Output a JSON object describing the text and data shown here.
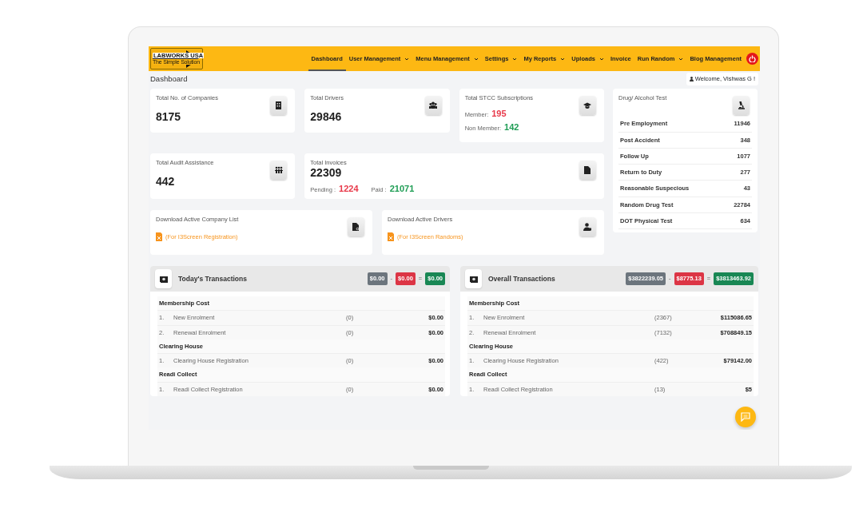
{
  "nav": {
    "logo_title": "LABWORKS USA",
    "logo_tagline": "The Simple Solution",
    "items": [
      {
        "label": "Dashboard",
        "selected": true,
        "dropdown": false
      },
      {
        "label": "User Management",
        "selected": false,
        "dropdown": true
      },
      {
        "label": "Menu Management",
        "selected": false,
        "dropdown": true
      },
      {
        "label": "Settings",
        "selected": false,
        "dropdown": true
      },
      {
        "label": "My Reports",
        "selected": false,
        "dropdown": true
      },
      {
        "label": "Uploads",
        "selected": false,
        "dropdown": true
      },
      {
        "label": "Invoice",
        "selected": false,
        "dropdown": false
      },
      {
        "label": "Run Random",
        "selected": false,
        "dropdown": true
      },
      {
        "label": "Blog Management",
        "selected": false,
        "dropdown": false
      }
    ]
  },
  "page_title": "Dashboard",
  "welcome": "Welcome, Vishwas G !",
  "stat_cards": [
    {
      "kind": "count",
      "title": "Total No. of Companies",
      "value": "8175"
    },
    {
      "kind": "count",
      "title": "Total Drivers",
      "value": "29846"
    },
    {
      "kind": "split",
      "title": "Total STCC Subscriptions",
      "lines": [
        {
          "label": "Member:",
          "value": "195",
          "color": "#e8394a"
        },
        {
          "label": "Non Member:",
          "value": "142",
          "color": "#1f9d55"
        }
      ]
    },
    {
      "kind": "count",
      "title": "Total Audit Assistance",
      "value": "442"
    },
    {
      "kind": "invoice",
      "title": "Total Invoices",
      "value": "22309",
      "lines": [
        {
          "label": "Pending :",
          "value": "1224",
          "color": "#e8394a"
        },
        {
          "label": "Paid :",
          "value": "21071",
          "color": "#1f9d55"
        }
      ]
    },
    {
      "kind": "download",
      "title": "Download Active Company List",
      "link": "(For I3Screen Registration)"
    },
    {
      "kind": "download",
      "title": "Download Active Drivers",
      "link": "(For I3Screen Randoms)"
    }
  ],
  "drug_test": {
    "title": "Drug/ Alcohol Test",
    "rows": [
      {
        "label": "Pre Employment",
        "count": "11946"
      },
      {
        "label": "Post Accident",
        "count": "348"
      },
      {
        "label": "Follow Up",
        "count": "1077"
      },
      {
        "label": "Return to Duty",
        "count": "277"
      },
      {
        "label": "Reasonable Suspecious",
        "count": "43"
      },
      {
        "label": "Random Drug Test",
        "count": "22784"
      },
      {
        "label": "DOT Physical Test",
        "count": "634"
      }
    ]
  },
  "transactions": [
    {
      "title": "Today's Transactions",
      "badges": [
        {
          "text": "$0.00",
          "color": "#6c757d"
        },
        {
          "text": "$0.00",
          "color": "#dc3545"
        },
        {
          "text": "$0.00",
          "color": "#198754"
        }
      ],
      "operators": [
        "-",
        "="
      ],
      "sections": [
        {
          "title": "Membership Cost",
          "rows": [
            {
              "number": "1.",
              "label": "New Enrolment",
              "count": "(0)",
              "amount": "$0.00"
            },
            {
              "number": "2.",
              "label": "Renewal Enrolment",
              "count": "(0)",
              "amount": "$0.00"
            }
          ]
        },
        {
          "title": "Clearing House",
          "rows": [
            {
              "number": "1.",
              "label": "Clearing House Registration",
              "count": "(0)",
              "amount": "$0.00"
            }
          ]
        },
        {
          "title": "Readi Collect",
          "rows": [
            {
              "number": "1.",
              "label": "Readi Collect Registration",
              "count": "(0)",
              "amount": "$0.00"
            }
          ]
        }
      ]
    },
    {
      "title": "Overall Transactions",
      "badges": [
        {
          "text": "$3822239.05",
          "color": "#6c757d"
        },
        {
          "text": "$8775.13",
          "color": "#dc3545"
        },
        {
          "text": "$3813463.92",
          "color": "#198754"
        }
      ],
      "operators": [
        "-",
        "="
      ],
      "sections": [
        {
          "title": "Membership Cost",
          "rows": [
            {
              "number": "1.",
              "label": "New Enrolment",
              "count": "(2367)",
              "amount": "$115086.65"
            },
            {
              "number": "2.",
              "label": "Renewal Enrolment",
              "count": "(7132)",
              "amount": "$708849.15"
            }
          ]
        },
        {
          "title": "Clearing House",
          "rows": [
            {
              "number": "1.",
              "label": "Clearing House Registration",
              "count": "(422)",
              "amount": "$79142.00"
            }
          ]
        },
        {
          "title": "Readi Collect",
          "rows": [
            {
              "number": "1.",
              "label": "Readi Collect Registration",
              "count": "(13)",
              "amount": "$5"
            }
          ]
        }
      ]
    }
  ]
}
